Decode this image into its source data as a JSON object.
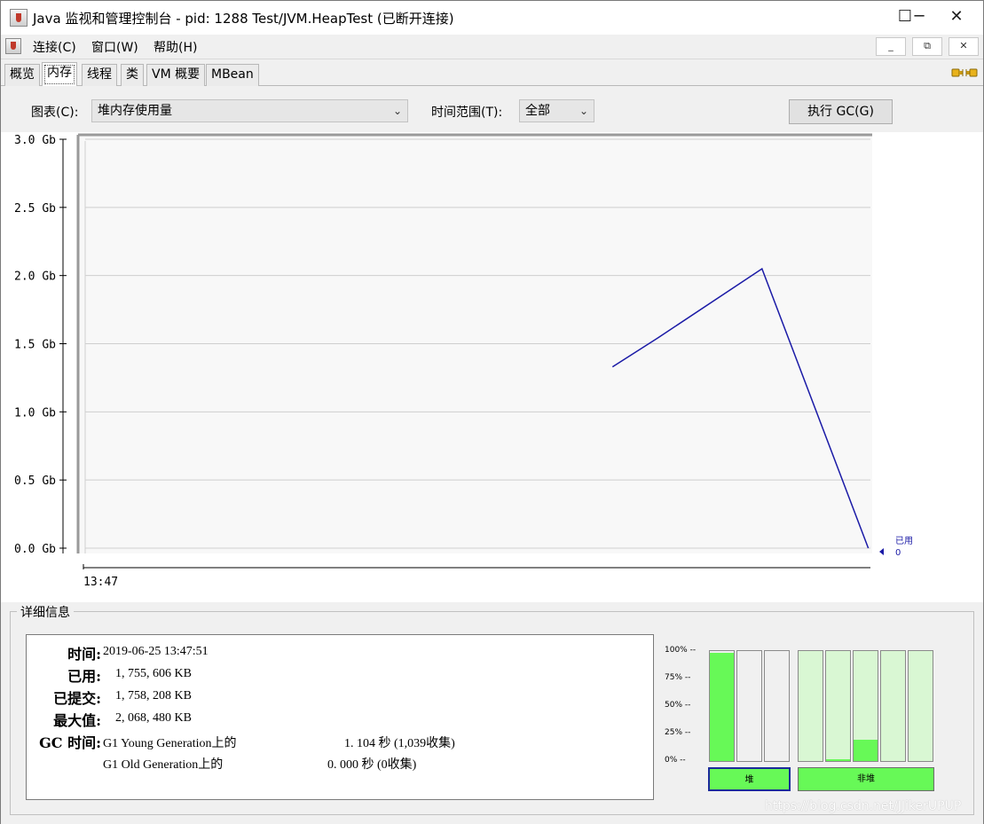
{
  "window": {
    "title": "Java 监视和管理控制台 - pid: 1288 Test/JVM.HeapTest (已断开连接)",
    "minimize": "─",
    "maximize": "☐",
    "close": "✕"
  },
  "menu": {
    "items": [
      "连接(C)",
      "窗口(W)",
      "帮助(H)"
    ],
    "mdi_minimize": "_",
    "mdi_restore": "⧉",
    "mdi_close": "✕"
  },
  "tabs": [
    "概览",
    "内存",
    "线程",
    "类",
    "VM 概要",
    "MBean"
  ],
  "active_tab": "内存",
  "controls": {
    "chart_label": "图表(C):",
    "chart_value": "堆内存使用量",
    "range_label": "时间范围(T):",
    "range_value": "全部",
    "gc_button": "执行 GC(G)"
  },
  "chart_data": {
    "type": "line",
    "ylim": [
      0,
      3.0
    ],
    "y_unit": "Gb",
    "y_ticks": [
      "3.0 Gb",
      "2.5 Gb",
      "2.0 Gb",
      "1.5 Gb",
      "1.0 Gb",
      "0.5 Gb",
      "0.0 Gb"
    ],
    "y_tick_values": [
      3.0,
      2.5,
      2.0,
      1.5,
      1.0,
      0.5,
      0.0
    ],
    "x_ticks": [
      "13:47"
    ],
    "grid": true,
    "series": [
      {
        "name": "已用",
        "color": "#1a1aa6",
        "points": [
          {
            "t": 0.67,
            "v": 1.33
          },
          {
            "t": 0.727,
            "v": 1.54
          },
          {
            "t": 0.86,
            "v": 2.05
          },
          {
            "t": 0.995,
            "v": 0.0
          }
        ]
      }
    ],
    "current_label": "已用",
    "current_value": "0"
  },
  "details": {
    "title": "详细信息",
    "rows": [
      {
        "key": "时间:",
        "value": "2019-06-25 13:47:51"
      },
      {
        "key": "已用:",
        "value": "1, 755, 606 KB"
      },
      {
        "key": "已提交:",
        "value": "1, 758, 208 KB"
      },
      {
        "key": "最大值:",
        "value": "2, 068, 480 KB"
      },
      {
        "key": "GC 时间:",
        "value": "G1 Young Generation上的",
        "extra": "1. 104  秒 (1,039收集)"
      },
      {
        "key": "",
        "value": "G1 Old Generation上的",
        "extra": "0. 000  秒 (0收集)"
      }
    ]
  },
  "pool_bars": {
    "ticks": [
      "100% --",
      "75% --",
      "50% --",
      "25% --",
      "0% --"
    ],
    "heap_button": "堆",
    "nonheap_button": "非堆",
    "fill_color": "#67f957",
    "heap": [
      0.98,
      0.0,
      0.0
    ],
    "nonheap": [
      0.0,
      0.02,
      0.19,
      0.0,
      0.0
    ]
  },
  "watermark": "https://blog.csdn.net/JJikerUPUP"
}
